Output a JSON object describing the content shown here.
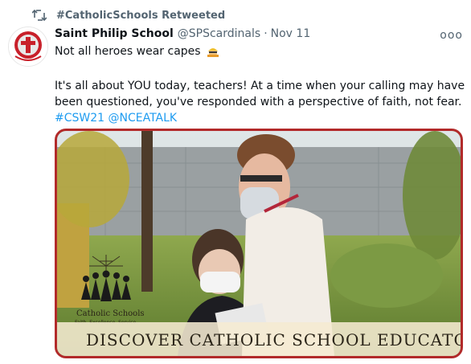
{
  "retweet": {
    "label": "#CatholicSchools Retweeted"
  },
  "tweet": {
    "author_name": "Saint Philip School",
    "author_handle": "@SPScardinals",
    "separator": "·",
    "date": "Nov 11",
    "more_label": "ooo",
    "line1": "Not all heroes wear capes",
    "line2": "It's all about YOU today, teachers!  At a time when your calling may have",
    "line3": "been questioned, you've responded with a perspective of faith, not fear.",
    "hashtags": "#CSW21 @NCEATALK"
  },
  "media": {
    "banner_text": "DISCOVER CATHOLIC SCHOOL EDUCATORS",
    "logo_name": "Catholic Schools",
    "logo_tagline": "Faith. Excellence. Service.",
    "border_color": "#b22a2a"
  },
  "colors": {
    "link": "#1d9bf0",
    "muted": "#536471",
    "text": "#0f1419"
  }
}
